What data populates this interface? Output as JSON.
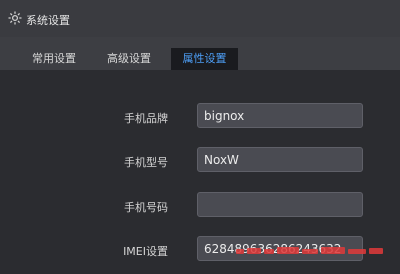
{
  "window": {
    "title": "系统设置",
    "icon": "gear-icon"
  },
  "tabs": [
    {
      "label": "常用设置",
      "active": false
    },
    {
      "label": "高级设置",
      "active": false
    },
    {
      "label": "属性设置",
      "active": true
    }
  ],
  "form": {
    "brand": {
      "label": "手机品牌",
      "value": "bignox"
    },
    "model": {
      "label": "手机型号",
      "value": "NoxW"
    },
    "number": {
      "label": "手机号码",
      "value": ""
    },
    "imei": {
      "label": "IMEI设置",
      "value": "628489636286243632"
    }
  },
  "colors": {
    "active_tab_text": "#4d9ef5",
    "watermark": "#e03a3a"
  }
}
